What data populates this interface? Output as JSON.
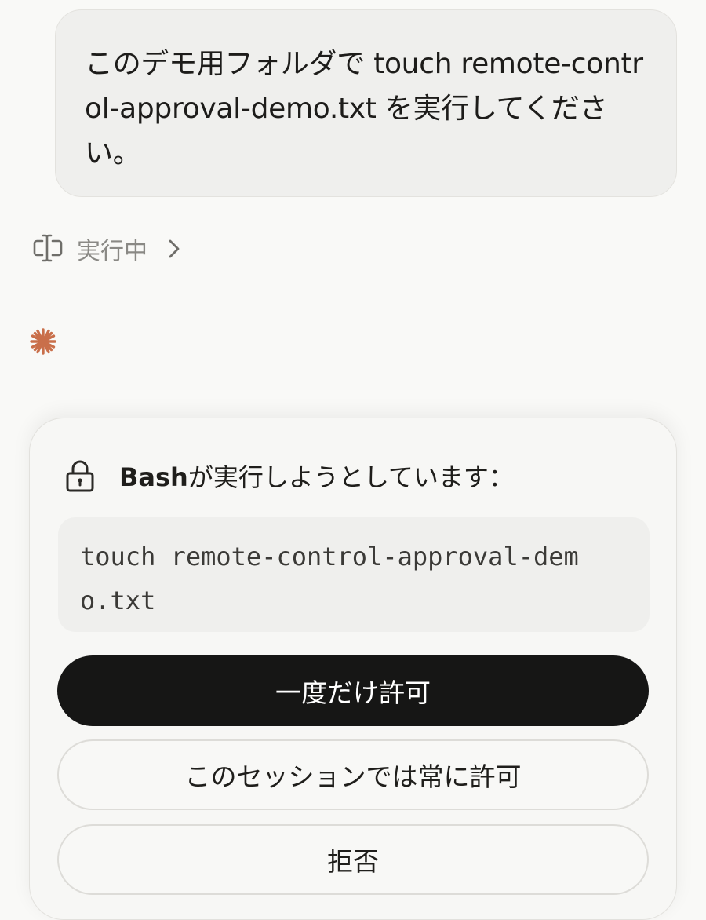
{
  "user_message": {
    "text": "このデモ用フォルダで touch remote-control-approval-demo.txt を実行してください。"
  },
  "status": {
    "icon": "tool-cursor-icon",
    "label": "実行中",
    "chevron_icon": "chevron-right-icon"
  },
  "activity": {
    "icon": "spark-icon",
    "color": "#c96f4a"
  },
  "permission": {
    "icon": "lock-icon",
    "tool_name": "Bash",
    "message": "が実行しようとしています：",
    "command": "touch remote-control-approval-demo.txt",
    "buttons": {
      "allow_once": "一度だけ許可",
      "allow_session": "このセッションでは常に許可",
      "deny": "拒否"
    }
  },
  "colors": {
    "background": "#f9f9f7",
    "primary_button": "#161615",
    "accent": "#c96f4a"
  }
}
